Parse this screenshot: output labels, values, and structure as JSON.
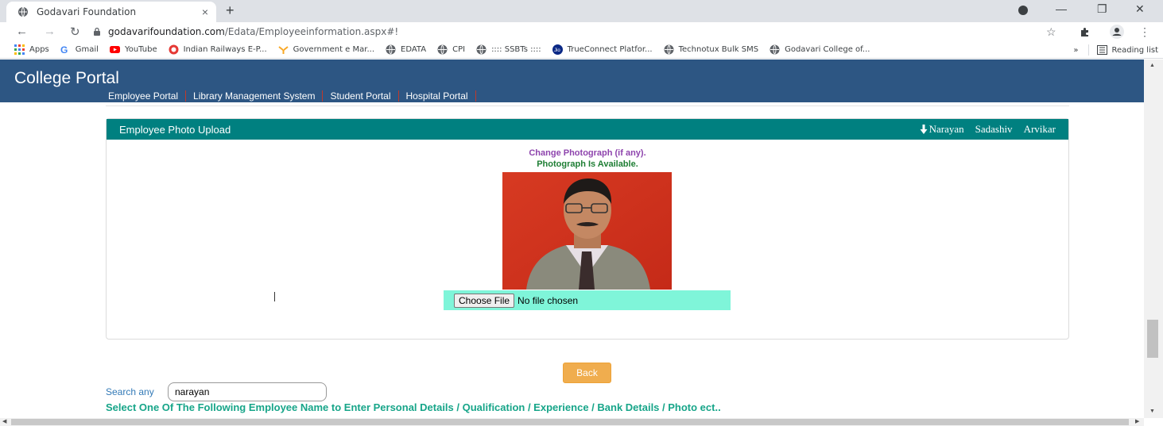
{
  "browser": {
    "tab_title": "Godavari Foundation",
    "tab_close": "×",
    "new_tab": "+",
    "url_domain": "godavarifoundation.com",
    "url_path": "/Edata/Employeeinformation.aspx#!",
    "window_minimize": "—",
    "window_restore": "❐",
    "window_close": "✕"
  },
  "bookmarks": [
    {
      "label": "Apps",
      "icon": "apps-grid-icon",
      "color": "#4285f4"
    },
    {
      "label": "Gmail",
      "icon": "google-icon",
      "color": "#4285f4"
    },
    {
      "label": "YouTube",
      "icon": "youtube-icon",
      "color": "#ff0000"
    },
    {
      "label": "Indian Railways E-P...",
      "icon": "railways-icon",
      "color": "#e53935"
    },
    {
      "label": "Government e Mar...",
      "icon": "gem-icon",
      "color": "#f9a825"
    },
    {
      "label": "EDATA",
      "icon": "globe-icon",
      "color": "#5f6368"
    },
    {
      "label": "CPI",
      "icon": "globe-icon",
      "color": "#5f6368"
    },
    {
      "label": ":::: SSBTs ::::",
      "icon": "globe-icon",
      "color": "#5f6368"
    },
    {
      "label": "TrueConnect Platfor...",
      "icon": "jio-icon",
      "color": "#0a2885"
    },
    {
      "label": "Technotux Bulk SMS",
      "icon": "globe-icon",
      "color": "#5f6368"
    },
    {
      "label": "Godavari College of...",
      "icon": "globe-icon",
      "color": "#5f6368"
    }
  ],
  "bookmarks_more": "»",
  "reading_list": "Reading list",
  "portal": {
    "title": "College Portal",
    "nav": [
      "Employee Portal",
      "Library Management System",
      "Student Portal",
      "Hospital Portal"
    ]
  },
  "panel": {
    "title": "Employee Photo Upload",
    "employee_name": [
      "Narayan",
      "Sadashiv",
      "Arvikar"
    ],
    "change_photo": "Change Photograph (if any).",
    "photo_status": "Photograph Is Available.",
    "choose_file": "Choose File",
    "no_file": "No file chosen"
  },
  "back_label": "Back",
  "search": {
    "label": "Search any",
    "value": "narayan"
  },
  "select_note": "Select One Of The Following Employee Name to Enter Personal Details / Qualification / Experience / Bank Details / Photo ect..",
  "colors": {
    "header": "#2d5683",
    "panel_head": "#008080",
    "file_bg": "#7ff5d9",
    "back": "#f0ad4e"
  }
}
